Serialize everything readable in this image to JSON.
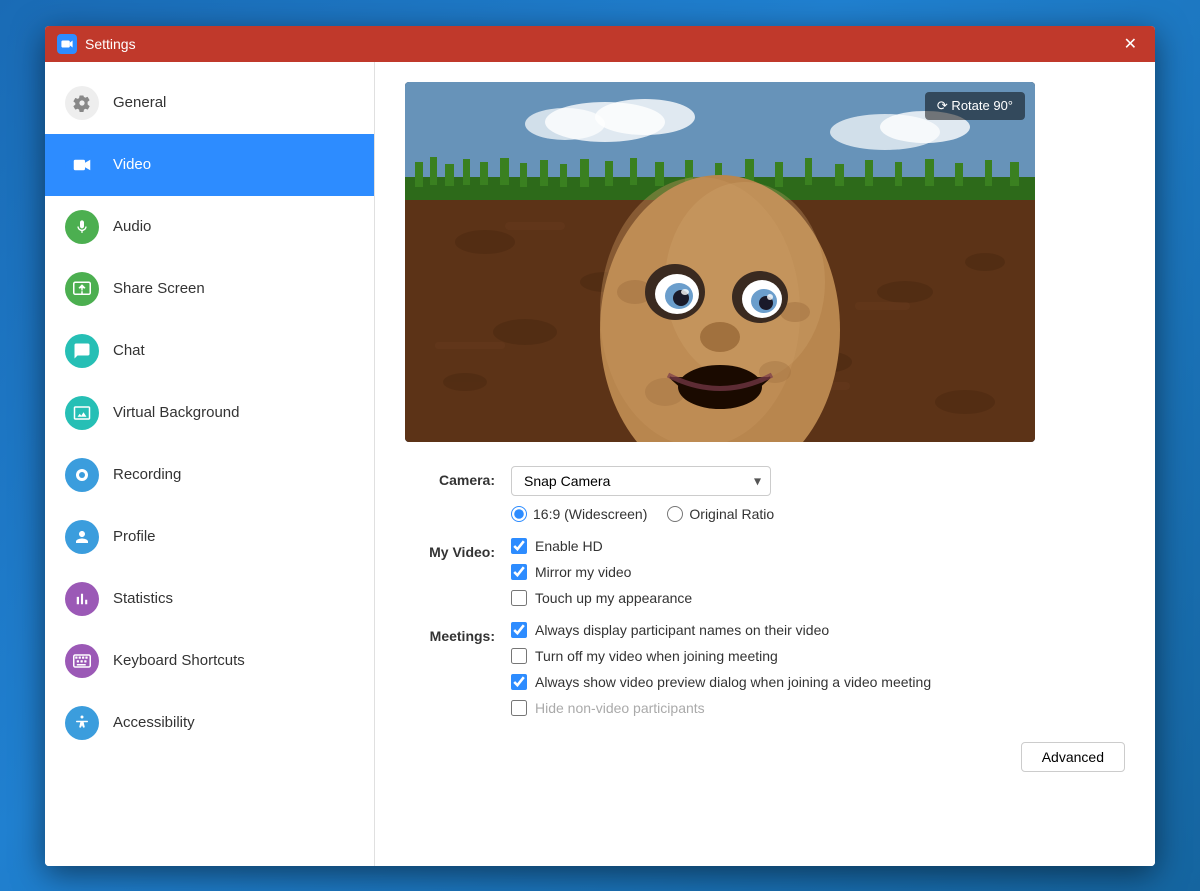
{
  "window": {
    "title": "Settings",
    "close_label": "✕"
  },
  "sidebar": {
    "items": [
      {
        "id": "general",
        "label": "General",
        "icon_color": "#888",
        "icon": "gear",
        "active": false
      },
      {
        "id": "video",
        "label": "Video",
        "icon_color": "#2d8cff",
        "icon": "video",
        "active": true
      },
      {
        "id": "audio",
        "label": "Audio",
        "icon_color": "#4CAF50",
        "icon": "audio",
        "active": false
      },
      {
        "id": "share-screen",
        "label": "Share Screen",
        "icon_color": "#4CAF50",
        "icon": "share",
        "active": false
      },
      {
        "id": "chat",
        "label": "Chat",
        "icon_color": "#26BFB5",
        "icon": "chat",
        "active": false
      },
      {
        "id": "virtual-background",
        "label": "Virtual Background",
        "icon_color": "#26BFB5",
        "icon": "background",
        "active": false
      },
      {
        "id": "recording",
        "label": "Recording",
        "icon_color": "#3b9ddd",
        "icon": "recording",
        "active": false
      },
      {
        "id": "profile",
        "label": "Profile",
        "icon_color": "#3b9ddd",
        "icon": "profile",
        "active": false
      },
      {
        "id": "statistics",
        "label": "Statistics",
        "icon_color": "#9b59b6",
        "icon": "stats",
        "active": false
      },
      {
        "id": "keyboard-shortcuts",
        "label": "Keyboard Shortcuts",
        "icon_color": "#9b59b6",
        "icon": "keyboard",
        "active": false
      },
      {
        "id": "accessibility",
        "label": "Accessibility",
        "icon_color": "#3b9ddd",
        "icon": "accessibility",
        "active": false
      }
    ]
  },
  "video_settings": {
    "rotate_btn_label": "⟳ Rotate 90°",
    "camera_label": "Camera:",
    "camera_value": "Snap Camera",
    "ratio_options": [
      {
        "id": "widescreen",
        "label": "16:9 (Widescreen)",
        "checked": true
      },
      {
        "id": "original",
        "label": "Original Ratio",
        "checked": false
      }
    ],
    "my_video_label": "My Video:",
    "my_video_options": [
      {
        "id": "enable-hd",
        "label": "Enable HD",
        "checked": true
      },
      {
        "id": "mirror-video",
        "label": "Mirror my video",
        "checked": true
      },
      {
        "id": "touch-up",
        "label": "Touch up my appearance",
        "checked": false
      }
    ],
    "meetings_label": "Meetings:",
    "meetings_options": [
      {
        "id": "display-names",
        "label": "Always display participant names on their video",
        "checked": true
      },
      {
        "id": "turn-off-video",
        "label": "Turn off my video when joining meeting",
        "checked": false
      },
      {
        "id": "show-preview",
        "label": "Always show video preview dialog when joining a video meeting",
        "checked": true
      },
      {
        "id": "hide-video",
        "label": "Hide non-video participants",
        "checked": false
      }
    ],
    "advanced_btn_label": "Advanced"
  }
}
